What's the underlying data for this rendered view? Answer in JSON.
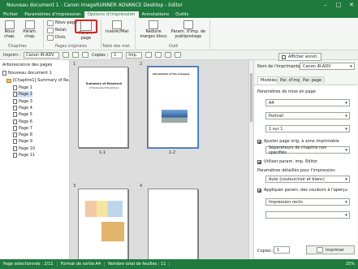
{
  "titlebar": {
    "title": "Nouveau document 1 - Canon imageRUNNER ADVANCE Desktop - Editor",
    "min": "–",
    "max": "□",
    "close": "✕"
  },
  "ribbon_tabs": [
    "Fichier",
    "Paramètres d'impression",
    "Options d'impression",
    "Annotations",
    "Outils"
  ],
  "ribbon": {
    "new_chapter": "Nouv\nchap.",
    "chapter_settings": "Param.\nchap.",
    "new_page": "Nouv page",
    "rotate": "Rotat.",
    "divide": "Divis.",
    "page_settings": "Param.\npage",
    "insert_file": "Insérer/Mat",
    "reduce_blank": "Réduire\nmarges blocs",
    "print_settings": "Param. d'imp. de\npublipostage",
    "group_chapters": "Chapitres",
    "group_original_pages": "Pages originales",
    "group_tables": "Table des mat.",
    "group_tools": "Outil"
  },
  "toolbar": {
    "zoom_label": "Copies :",
    "copies": "1",
    "print_menu": "Imp."
  },
  "printer_row": {
    "label": "Imprim :",
    "value": "Canon iR-ADV"
  },
  "tree": {
    "title": "Arborescence des pages",
    "root": "Nouveau document 1",
    "chapter": "[Chapitre1] Summary of Re...",
    "pages": [
      "Page 1",
      "Page 2",
      "Page 3",
      "Page 4",
      "Page 5",
      "Page 6",
      "Page 7",
      "Page 8",
      "Page 9",
      "Page 10",
      "Page 11"
    ]
  },
  "thumbs": {
    "numbers": [
      "1",
      "2",
      "3",
      "4"
    ],
    "labels": [
      "1-1",
      "1-2"
    ],
    "page1_title": "Summary of Research",
    "page1_sub": "of Development Manufacture",
    "page2_title": "Introduction of the Company"
  },
  "right": {
    "display_annot": "Afficher annot.",
    "printer_label": "Nom de l'imprimante :",
    "printer_value": "Canon iR-ADV",
    "tabs": [
      "Modèles",
      "Par. d'imp.",
      "Par. page"
    ],
    "layout_header": "Paramètres de mise en page",
    "paper_size": "A4",
    "orientation": "Portrait",
    "pages_per_sheet": "1 sur 1",
    "fit_page": "Ajuster page orig. à zone imprimable",
    "chapter_sep": "Séparateurs de chapitre non spécifiés",
    "use_editor": "Utiliser param. imp. Editor",
    "detail_header": "Paramètres détaillés pour l'impression",
    "color_mode": "Auto (couleur/noir et blanc)",
    "apply_colors": "Appliquer param. des couleurs à l'aperçu",
    "print_sides": "Impression recto",
    "finishing": "",
    "copies_label": "Copies :",
    "copies_value": "1",
    "print_button": "Imprimer"
  },
  "status": {
    "selected": "Page sélectionnée : 2/11",
    "format": "Format de sortie:A4",
    "sheets": "Nombre total de feuilles : 11",
    "zoom": "25%"
  },
  "colors": {
    "brand": "#1f7a3e",
    "highlight": "#e02020"
  }
}
